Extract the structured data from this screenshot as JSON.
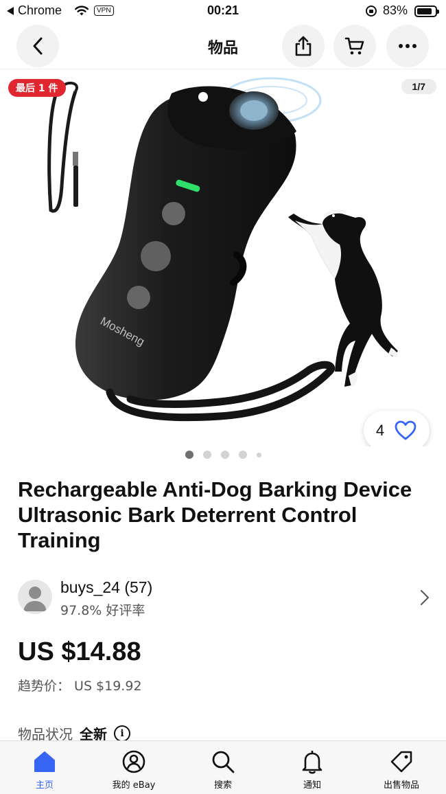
{
  "status_bar": {
    "back_app": "Chrome",
    "vpn": "VPN",
    "time": "00:21",
    "battery": "83%"
  },
  "header": {
    "title": "物品"
  },
  "gallery": {
    "badge": "最后 1 件",
    "counter": "1/7",
    "device_brand": "Mosheng",
    "watch_count": "4",
    "dots": 5,
    "active_dot": 0
  },
  "item": {
    "title": "Rechargeable Anti-Dog Barking Device Ultrasonic Bark Deterrent Control Training",
    "seller_name": "buys_24 (57)",
    "seller_rating": "97.8% 好评率",
    "price": "US $14.88",
    "trend_price": "趋势价： US $19.92",
    "condition_label": "物品状况",
    "condition_value": "全新"
  },
  "tabbar": {
    "tabs": [
      {
        "label": "主页",
        "icon": "home-icon",
        "active": true
      },
      {
        "label": "我的 eBay",
        "icon": "profile-icon",
        "active": false
      },
      {
        "label": "搜索",
        "icon": "search-icon",
        "active": false
      },
      {
        "label": "通知",
        "icon": "bell-icon",
        "active": false
      },
      {
        "label": "出售物品",
        "icon": "tag-icon",
        "active": false
      }
    ]
  },
  "colors": {
    "accent": "#3665f3",
    "badge_red": "#e0262f",
    "device_green_led": "#2ee06a"
  }
}
